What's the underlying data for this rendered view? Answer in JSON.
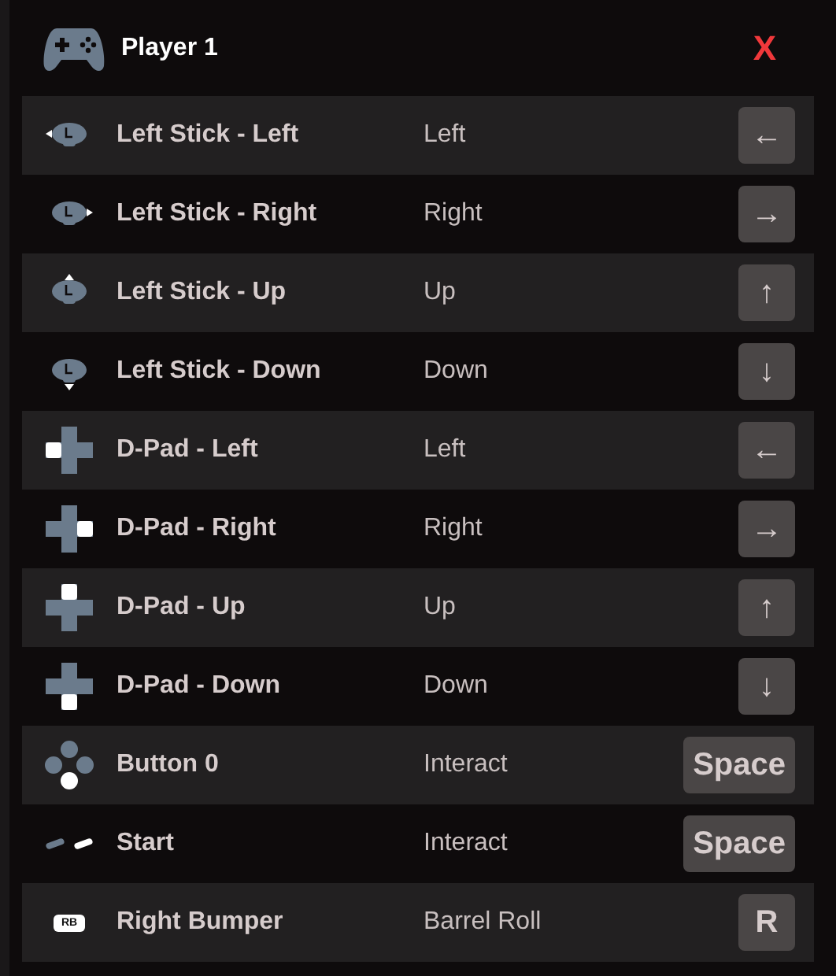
{
  "header": {
    "title": "Player 1",
    "close": "X"
  },
  "rows": [
    {
      "kind": "stick",
      "lit": {
        "up": false,
        "down": false,
        "left": true,
        "right": false
      },
      "name": "Left Stick - Left",
      "action": "Left",
      "key": "←"
    },
    {
      "kind": "stick",
      "lit": {
        "up": false,
        "down": false,
        "left": false,
        "right": true
      },
      "name": "Left Stick - Right",
      "action": "Right",
      "key": "→"
    },
    {
      "kind": "stick",
      "lit": {
        "up": true,
        "down": false,
        "left": false,
        "right": false
      },
      "name": "Left Stick - Up",
      "action": "Up",
      "key": "↑"
    },
    {
      "kind": "stick",
      "lit": {
        "up": false,
        "down": true,
        "left": false,
        "right": false
      },
      "name": "Left Stick - Down",
      "action": "Down",
      "key": "↓"
    },
    {
      "kind": "dpad",
      "lit": {
        "up": false,
        "down": false,
        "left": true,
        "right": false
      },
      "name": "D-Pad - Left",
      "action": "Left",
      "key": "←"
    },
    {
      "kind": "dpad",
      "lit": {
        "up": false,
        "down": false,
        "left": false,
        "right": true
      },
      "name": "D-Pad - Right",
      "action": "Right",
      "key": "→"
    },
    {
      "kind": "dpad",
      "lit": {
        "up": true,
        "down": false,
        "left": false,
        "right": false
      },
      "name": "D-Pad - Up",
      "action": "Up",
      "key": "↑"
    },
    {
      "kind": "dpad",
      "lit": {
        "up": false,
        "down": true,
        "left": false,
        "right": false
      },
      "name": "D-Pad - Down",
      "action": "Down",
      "key": "↓"
    },
    {
      "kind": "face",
      "lit": {
        "up": false,
        "down": true,
        "left": false,
        "right": false
      },
      "name": "Button 0",
      "action": "Interact",
      "key": "Space"
    },
    {
      "kind": "start",
      "name": "Start",
      "action": "Interact",
      "key": "Space"
    },
    {
      "kind": "bumper",
      "badge": "RB",
      "name": "Right Bumper",
      "action": "Barrel Roll",
      "key": "R"
    }
  ]
}
